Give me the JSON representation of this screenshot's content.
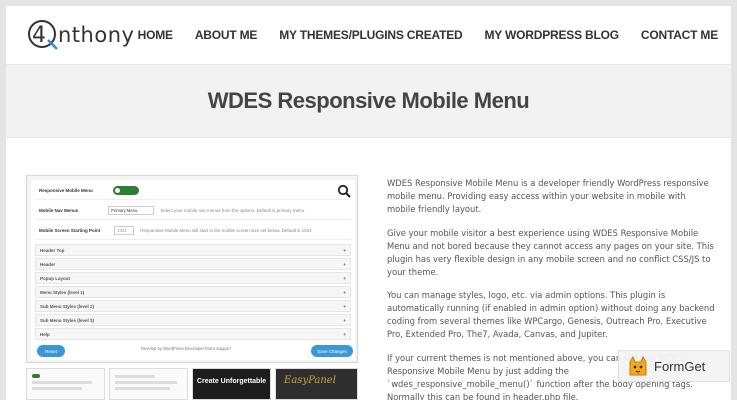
{
  "site": {
    "logo_text": "nthony",
    "logo_mark": "4"
  },
  "nav": {
    "items": [
      "HOME",
      "ABOUT ME",
      "MY THEMES/PLUGINS CREATED",
      "MY WORDPRESS BLOG",
      "CONTACT ME"
    ]
  },
  "page": {
    "title": "WDES Responsive Mobile Menu"
  },
  "plugin_screenshot": {
    "rows": [
      {
        "label": "Responsive Mobile Menu",
        "control": "Enabled"
      },
      {
        "label": "Mobile Nav Menus",
        "control": "Primary Menu",
        "help": "Select your mobile nav menus from the options. Default is primary menu."
      },
      {
        "label": "Mobile Screen Starting Point",
        "control": "1024",
        "help": "Responsive Mobile Menu will start in the mobile screen size set below. Default is 1024"
      }
    ],
    "sections": [
      "Header Top",
      "Header",
      "Popup Layout",
      "Menu Styles (level 1)",
      "Sub Menu Styles (level 2)",
      "Sub Menu Styles (level 3)",
      "Help"
    ],
    "reset_label": "Reset",
    "save_label": "Save Changes",
    "footer_note": "Develop by WordPress Developer Extra Support",
    "thumb3_text": "Create Unforgettable"
  },
  "description": {
    "paragraphs": [
      "WDES Responsive Mobile Menu is a developer friendly WordPress responsive mobile menu. Providing easy access within your website in mobile with mobile friendly layout.",
      "Give your mobile visitor a best experience using WDES Responsive Mobile Menu and not bored because they cannot access any pages on your site. This plugin has very flexible design in any mobile screen and no conflict CSS/JS to your theme.",
      "You can manage styles, logo, etc. via admin options. This plugin is automatically running (if enabled in admin option) without doing any backend coding from several themes like WPCargo, Genesis, Outreach Pro, Executive Pro, Extended Pro, The7, Avada, Canvas, and Jupiter.",
      "If your current themes is not mentioned above, you can still use WDES Responsive Mobile Menu by just adding the `wdes_responsive_mobile_menu()` function after the body opening tags. Normally this can be found in header.php file."
    ]
  },
  "badge": {
    "text": "FormGet"
  },
  "colors": {
    "toggle_green": "#2e7d32",
    "button_blue": "#3c97d6",
    "title_band": "#f2f2f2"
  }
}
